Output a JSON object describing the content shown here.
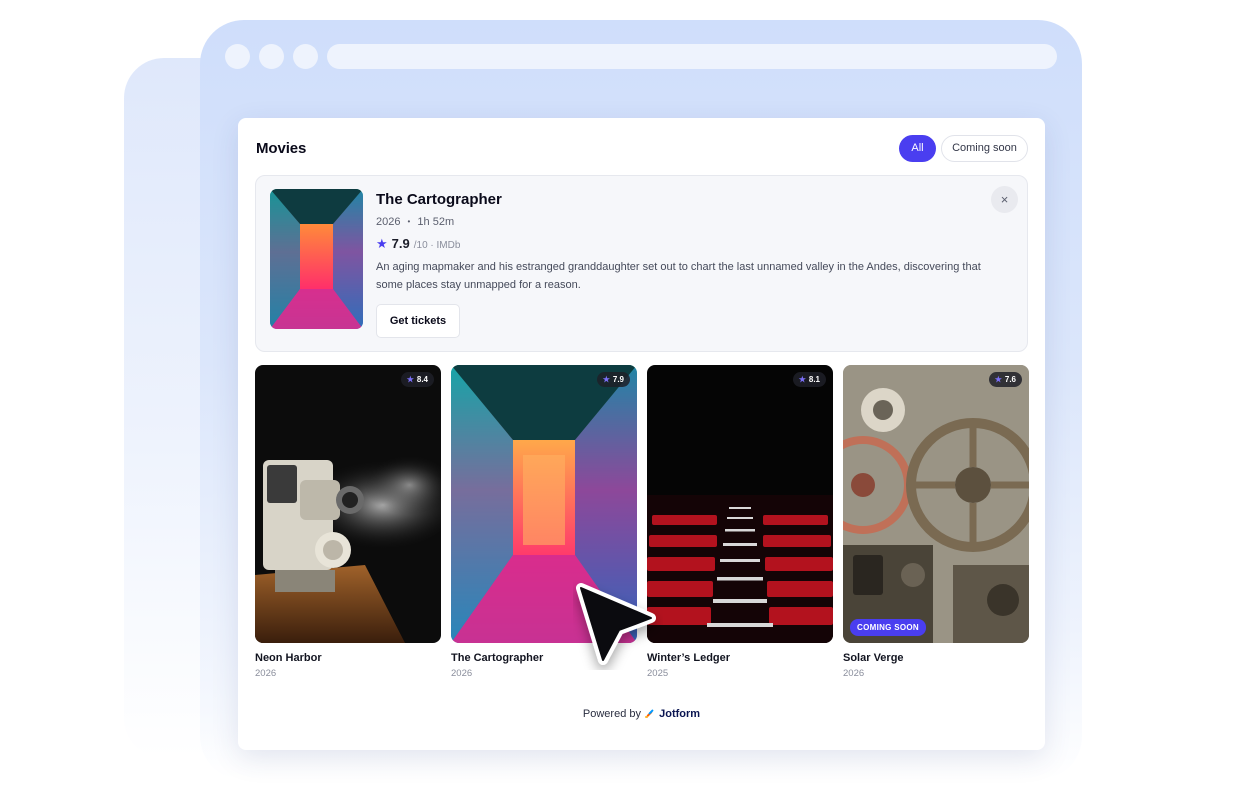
{
  "widget": {
    "title": "Movies",
    "filters": [
      {
        "label": "All",
        "active": true
      },
      {
        "label": "Coming soon",
        "active": false
      }
    ]
  },
  "featured": {
    "title": "The Cartographer",
    "year": "2026",
    "separator": "•",
    "duration": "1h 52m",
    "rating": "7.9",
    "rating_scale": "/10 · IMDb",
    "description": "An aging mapmaker and his estranged granddaughter set out to chart the last unnamed valley in the Andes, discovering that some places stay unmapped for a reason.",
    "cta_label": "Get tickets",
    "close_icon": "×"
  },
  "movies": [
    {
      "title": "Neon Harbor",
      "year": "2026",
      "rating": "8.4",
      "coming_soon": false
    },
    {
      "title": "The Cartographer",
      "year": "2026",
      "rating": "7.9",
      "coming_soon": false
    },
    {
      "title": "Winter’s Ledger",
      "year": "2025",
      "rating": "8.1",
      "coming_soon": false
    },
    {
      "title": "Solar Verge",
      "year": "2026",
      "rating": "7.6",
      "coming_soon": true,
      "coming_soon_label": "COMING SOON"
    }
  ],
  "footer": {
    "powered_prefix": "Powered by",
    "brand": "Jotform"
  },
  "icons": {
    "star": "★",
    "close": "close-icon",
    "cursor": "pointer-cursor-icon"
  },
  "colors": {
    "accent": "#4a3ef0",
    "frame": "#cfdefb",
    "brand": "#0a1551"
  }
}
